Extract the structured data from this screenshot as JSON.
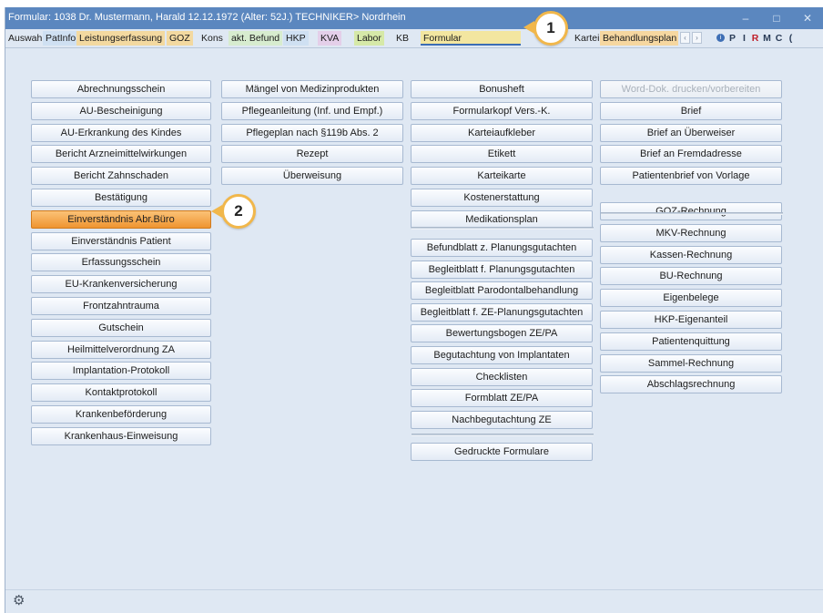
{
  "window": {
    "title": "Formular: 1038  Dr. Mustermann, Harald  12.12.1972 (Alter: 52J.)  TECHNIKER> Nordrhein",
    "minimize": "–",
    "maximize": "□",
    "close": "✕"
  },
  "tabs": [
    {
      "label": "Auswahl",
      "color": "#dfe8f3"
    },
    {
      "label": "PatInfo",
      "color": "#cfe0f2"
    },
    {
      "label": "Leistungserfassung",
      "color": "#f3d9a0"
    },
    {
      "label": "GOZ",
      "color": "#f3d9a0"
    },
    {
      "label": "Kons",
      "color": "#dfe8f3"
    },
    {
      "label": "akt. Befund",
      "color": "#d7eccf"
    },
    {
      "label": "HKP",
      "color": "#cfe0f2"
    },
    {
      "label": "KVA",
      "color": "#e4cfe9"
    },
    {
      "label": "Labor",
      "color": "#d6e9a8"
    },
    {
      "label": "KB",
      "color": "#dfe8f3"
    },
    {
      "label": "Formular",
      "color": "#f3e6a0"
    },
    {
      "label": "Kartei",
      "color": "#dfe8f3"
    },
    {
      "label": "Behandlungsplan",
      "color": "#f6d7a0"
    }
  ],
  "toolbar_letters": [
    "P",
    "I",
    "R",
    "M",
    "C",
    "("
  ],
  "toolbar_colors": {
    "R": "#c0202a"
  },
  "columns": {
    "col1": [
      "Abrechnungsschein",
      "AU-Bescheinigung",
      "AU-Erkrankung des Kindes",
      "Bericht Arzneimittelwirkungen",
      "Bericht Zahnschaden",
      "Bestätigung",
      "Einverständnis Abr.Büro",
      "Einverständnis Patient",
      "Erfassungsschein",
      "EU-Krankenversicherung",
      "Frontzahntrauma",
      "Gutschein",
      "Heilmittelverordnung ZA",
      "Implantation-Protokoll",
      "Kontaktprotokoll",
      "Krankenbeförderung",
      "Krankenhaus-Einweisung"
    ],
    "col2": [
      "Mängel von Medizinprodukten",
      "Pflegeanleitung (Inf. und Empf.)",
      "Pflegeplan nach §119b Abs. 2",
      "Rezept",
      "Überweisung"
    ],
    "col3a": [
      "Bonusheft",
      "Formularkopf Vers.-K.",
      "Karteiaufkleber",
      "Etikett",
      "Karteikarte",
      "Kostenerstattung",
      "Medikationsplan"
    ],
    "col3b": [
      "Befundblatt z. Planungsgutachten",
      "Begleitblatt f. Planungsgutachten",
      "Begleitblatt Parodontalbehandlung",
      "Begleitblatt f. ZE-Planungsgutachten",
      "Bewertungsbogen ZE/PA",
      "Begutachtung von Implantaten",
      "Checklisten",
      "Formblatt ZE/PA",
      "Nachbegutachtung ZE"
    ],
    "col3c": [
      "Gedruckte Formulare"
    ],
    "col4a": [
      "Word-Dok. drucken/vorbereiten",
      "Brief",
      "Brief an Überweiser",
      "Brief an Fremdadresse",
      "Patientenbrief von Vorlage"
    ],
    "col4b": [
      "GOZ-Rechnung",
      "MKV-Rechnung",
      "Kassen-Rechnung",
      "BU-Rechnung",
      "Eigenbelege",
      "HKP-Eigenanteil",
      "Patientenquittung",
      "Sammel-Rechnung",
      "Abschlagsrechnung"
    ]
  },
  "selected_item": "Einverständnis Abr.Büro",
  "disabled_item": "Word-Dok. drucken/vorbereiten",
  "callouts": [
    "1",
    "2"
  ],
  "status": {
    "settings_icon": "gear-icon"
  }
}
